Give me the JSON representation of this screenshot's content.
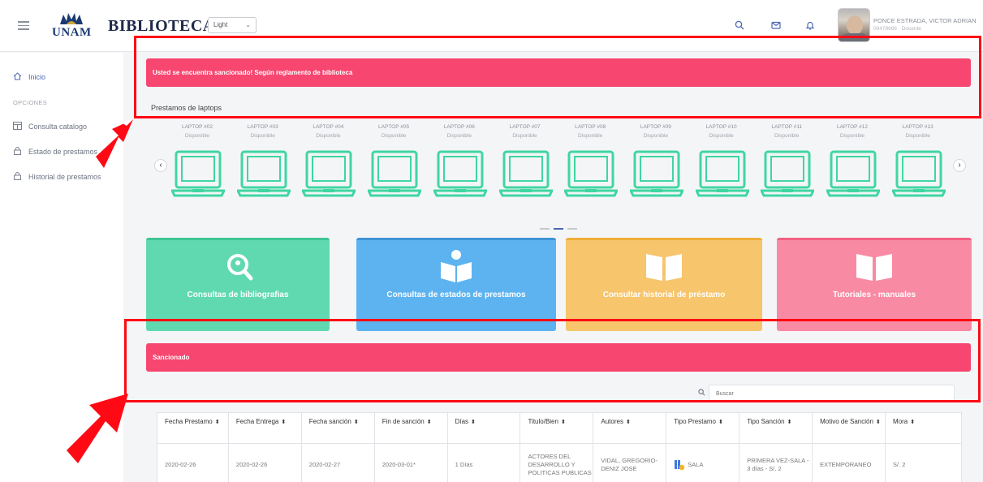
{
  "header": {
    "logo_text": "UNAM",
    "app_title": "BIBLIOTECA",
    "theme_select": "Light",
    "user": {
      "name": "PONCE ESTRADA, VICTOR ADRIAN",
      "role": "00478666 · Docente"
    }
  },
  "sidebar": {
    "home": "Inicio",
    "section": "OPCIONES",
    "items": [
      {
        "label": "Consulta catalogo",
        "icon": "table-icon"
      },
      {
        "label": "Estado de prestamos",
        "icon": "lock-icon"
      },
      {
        "label": "Historial de prestamos",
        "icon": "lock-icon"
      }
    ]
  },
  "alert": {
    "message": "Usted se encuentra sancionado! Según reglamento de biblioteca",
    "color": "#f7466f"
  },
  "laptops": {
    "title": "Prestamos de laptops",
    "items": [
      {
        "name": "LAPTOP #02",
        "status": "Disponible"
      },
      {
        "name": "LAPTOP #03",
        "status": "Disponible"
      },
      {
        "name": "LAPTOP #04",
        "status": "Disponible"
      },
      {
        "name": "LAPTOP #05",
        "status": "Disponible"
      },
      {
        "name": "LAPTOP #06",
        "status": "Disponible"
      },
      {
        "name": "LAPTOP #07",
        "status": "Disponible"
      },
      {
        "name": "LAPTOP #08",
        "status": "Disponible"
      },
      {
        "name": "LAPTOP #09",
        "status": "Disponible"
      },
      {
        "name": "LAPTOP #10",
        "status": "Disponible"
      },
      {
        "name": "LAPTOP #11",
        "status": "Disponible"
      },
      {
        "name": "LAPTOP #12",
        "status": "Disponible"
      },
      {
        "name": "LAPTOP #13",
        "status": "Disponible"
      }
    ],
    "prev_glyph": "‹",
    "next_glyph": "›",
    "laptop_color": "#3fd6a1"
  },
  "cards": [
    {
      "label": "Consultas de bibliografias",
      "icon": "search-location-icon"
    },
    {
      "label": "Consultas de estados de prestamos",
      "icon": "person-reading-icon"
    },
    {
      "label": "Consultar historial de préstamo",
      "icon": "open-book-icon"
    },
    {
      "label": "Tutoriales - manuales",
      "icon": "open-book-icon"
    }
  ],
  "sanctioned": {
    "title": "Sancionado",
    "search_placeholder": "Buscar",
    "columns": [
      "Fecha Prestamo",
      "Fecha Entrega",
      "Fecha sanción",
      "Fin de sanción",
      "Días",
      "Titulo/Bien",
      "Autores",
      "Tipo Prestamo",
      "Tipo Sanción",
      "Motivo de Sanción",
      "Mora"
    ],
    "sort_glyph": "⬍",
    "rows": [
      {
        "fecha_prestamo": "2020-02-26",
        "fecha_entrega": "2020-02-26",
        "fecha_sancion": "2020-02-27",
        "fin_sancion": "2020-03-01*",
        "dias": "1 Días",
        "titulo": "ACTORES DEL DESARROLLO Y POLITICAS PUBLICAS",
        "autores": "VIDAL, GREGORIO-DENIZ JOSE",
        "tipo_prestamo": "SALA",
        "tipo_sancion": "PRIMERA VEZ-SALA - 3 días - S/. 2",
        "motivo": "EXTEMPORANEO",
        "mora": "S/. 2"
      }
    ]
  }
}
